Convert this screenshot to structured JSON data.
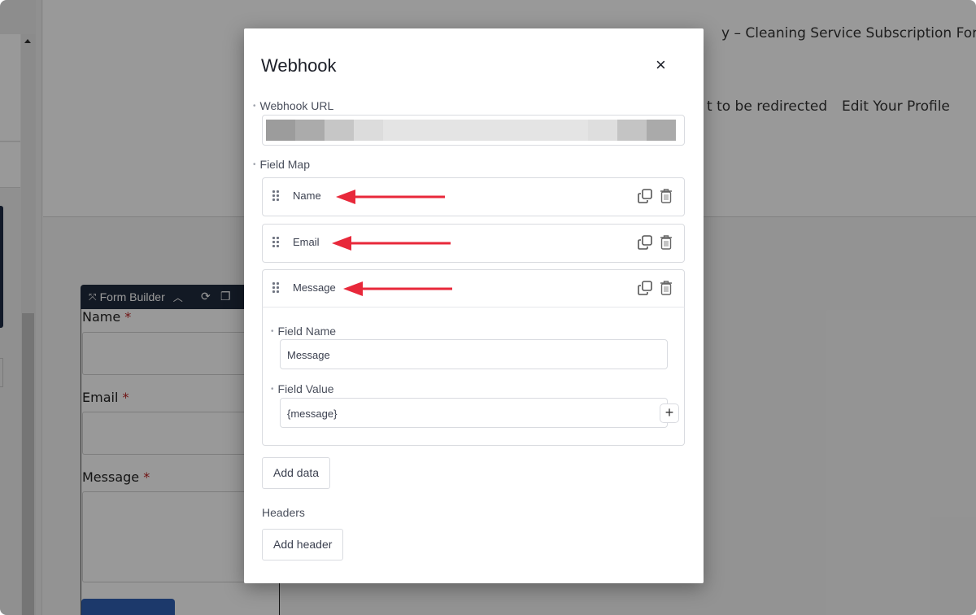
{
  "background": {
    "page_title": "y – Cleaning Service Subscription Form",
    "nav_links": [
      {
        "label": "t to be redirected"
      },
      {
        "label": "Edit Your Profile"
      }
    ],
    "form_builder": {
      "title": "Form Builder",
      "fields": [
        {
          "label": "Name",
          "required_mark": "*"
        },
        {
          "label": "Email",
          "required_mark": "*"
        },
        {
          "label": "Message",
          "required_mark": "*"
        }
      ]
    }
  },
  "modal": {
    "title": "Webhook",
    "close_icon": "×",
    "webhook_url": {
      "label": "Webhook URL",
      "value_redacted": true,
      "blur_colors": [
        "#9c9c9c",
        "#ababab",
        "#c6c6c6",
        "#dcdcdc",
        "#e4e4e4",
        "#e4e4e4",
        "#e4e4e4",
        "#e4e4e4",
        "#e4e4e4",
        "#e4e4e4",
        "#e4e4e4",
        "#dedede",
        "#c4c4c4",
        "#aaaaaa"
      ]
    },
    "field_map": {
      "label": "Field Map",
      "items": [
        {
          "name": "Name",
          "annotated": true
        },
        {
          "name": "Email",
          "annotated": true
        },
        {
          "name": "Message",
          "annotated": true,
          "expanded": true
        }
      ],
      "expanded_item": {
        "field_name_label": "Field Name",
        "field_name_value": "Message",
        "field_value_label": "Field Value",
        "field_value_value": "{message}",
        "insert_icon": "+"
      }
    },
    "add_data_label": "Add data",
    "headers_label": "Headers",
    "add_header_label": "Add header",
    "annotation_color": "#e8283a"
  }
}
